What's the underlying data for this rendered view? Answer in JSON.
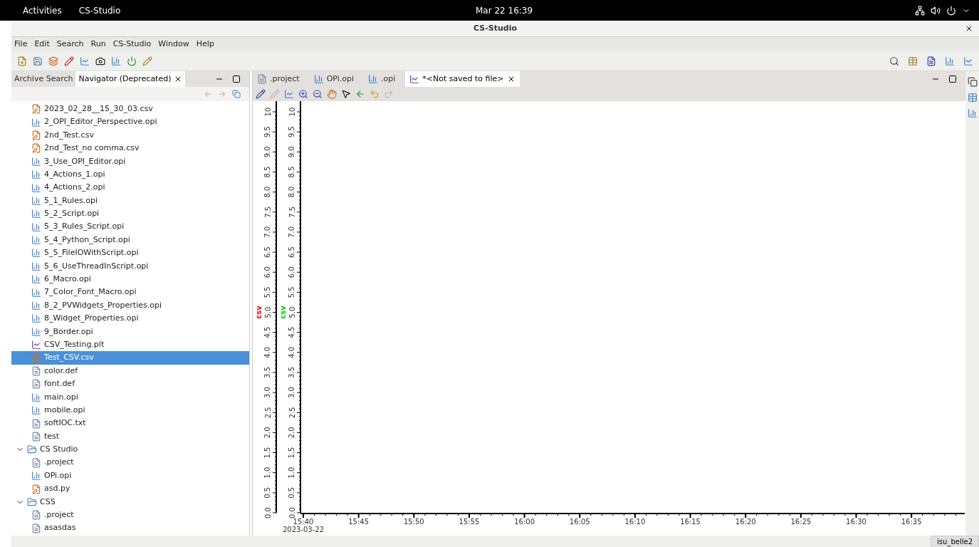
{
  "top_bar": {
    "activities": "Activities",
    "app_menu": "CS-Studio",
    "clock": "Mar 22  16:39"
  },
  "window": {
    "title": "CS-Studio"
  },
  "menu": [
    "File",
    "Edit",
    "Search",
    "Run",
    "CS-Studio",
    "Window",
    "Help"
  ],
  "left_tabs": [
    {
      "label": "Archive Search",
      "selected": false
    },
    {
      "label": "Navigator (Deprecated)",
      "selected": true
    }
  ],
  "tree": [
    {
      "name": "2023_02_28__15_30_03.csv",
      "kind": "csv",
      "selected": false
    },
    {
      "name": "2_OPI_Editor_Perspective.opi",
      "kind": "opi",
      "selected": false
    },
    {
      "name": "2nd_Test.csv",
      "kind": "csv",
      "selected": false
    },
    {
      "name": "2nd_Test_no comma.csv",
      "kind": "csv",
      "selected": false
    },
    {
      "name": "3_Use_OPI_Editor.opi",
      "kind": "opi",
      "selected": false
    },
    {
      "name": "4_Actions_1.opi",
      "kind": "opi",
      "selected": false
    },
    {
      "name": "4_Actions_2.opi",
      "kind": "opi",
      "selected": false
    },
    {
      "name": "5_1_Rules.opi",
      "kind": "opi",
      "selected": false
    },
    {
      "name": "5_2_Script.opi",
      "kind": "opi",
      "selected": false
    },
    {
      "name": "5_3_Rules_Script.opi",
      "kind": "opi",
      "selected": false
    },
    {
      "name": "5_4_Python_Script.opi",
      "kind": "opi",
      "selected": false
    },
    {
      "name": "5_5_FileIOWithScript.opi",
      "kind": "opi",
      "selected": false
    },
    {
      "name": "5_6_UseThreadInScript.opi",
      "kind": "opi",
      "selected": false
    },
    {
      "name": "6_Macro.opi",
      "kind": "opi",
      "selected": false
    },
    {
      "name": "7_Color_Font_Macro.opi",
      "kind": "opi",
      "selected": false
    },
    {
      "name": "8_2_PVWidgets_Properties.opi",
      "kind": "opi",
      "selected": false
    },
    {
      "name": "8_Widget_Properties.opi",
      "kind": "opi",
      "selected": false
    },
    {
      "name": "9_Border.opi",
      "kind": "opi",
      "selected": false
    },
    {
      "name": "CSV_Testing.plt",
      "kind": "plt",
      "selected": false
    },
    {
      "name": "Test_CSV.csv",
      "kind": "csv",
      "selected": true
    },
    {
      "name": "color.def",
      "kind": "file",
      "selected": false
    },
    {
      "name": "font.def",
      "kind": "file",
      "selected": false
    },
    {
      "name": "main.opi",
      "kind": "opi",
      "selected": false
    },
    {
      "name": "mobile.opi",
      "kind": "opi",
      "selected": false
    },
    {
      "name": "softIOC.txt",
      "kind": "file",
      "selected": false
    },
    {
      "name": "test",
      "kind": "file",
      "selected": false
    },
    {
      "name": "CS Studio",
      "kind": "folder",
      "expanded": true,
      "selected": false,
      "children": [
        {
          "name": ".project",
          "kind": "file",
          "selected": false
        },
        {
          "name": "OPi.opi",
          "kind": "opi",
          "selected": false
        },
        {
          "name": "asd.py",
          "kind": "csv",
          "selected": false
        }
      ]
    },
    {
      "name": "CSS",
      "kind": "folder",
      "expanded": true,
      "selected": false,
      "children": [
        {
          "name": ".project",
          "kind": "file",
          "selected": false
        },
        {
          "name": "asasdas",
          "kind": "file",
          "selected": false
        }
      ]
    }
  ],
  "editor_tabs": [
    {
      "label": ".project",
      "kind": "file",
      "selected": false
    },
    {
      "label": "OPi.opi",
      "kind": "opi",
      "selected": false
    },
    {
      "label": ".opi",
      "kind": "opi",
      "selected": false
    },
    {
      "label": "*<Not saved to file>",
      "kind": "plt",
      "selected": true
    }
  ],
  "plot": {
    "y_axes": [
      {
        "label": "csv",
        "color": "#ff0000",
        "ticks": [
          "0.0",
          "0.5",
          "1.0",
          "1.5",
          "2.0",
          "2.5",
          "3.0",
          "3.5",
          "4.0",
          "4.5",
          "5.0",
          "5.5",
          "6.0",
          "6.5",
          "7.0",
          "7.5",
          "8.0",
          "8.5",
          "9.0",
          "9.5",
          "10"
        ]
      },
      {
        "label": "csv",
        "color": "#00cc00",
        "ticks": [
          "0.0",
          "0.5",
          "1.0",
          "1.5",
          "2.0",
          "2.5",
          "3.0",
          "3.5",
          "4.0",
          "4.5",
          "5.0",
          "5.5",
          "6.0",
          "6.5",
          "7.0",
          "7.5",
          "8.0",
          "8.5",
          "9.0",
          "9.5",
          "10"
        ]
      }
    ],
    "x_ticks": [
      "15:40",
      "15:45",
      "15:50",
      "15:55",
      "16:00",
      "16:05",
      "16:10",
      "16:15",
      "16:20",
      "16:25",
      "16:30",
      "16:35"
    ],
    "x_date": "2023-03-22"
  },
  "status_bar": {
    "user": "isu_belle2"
  }
}
